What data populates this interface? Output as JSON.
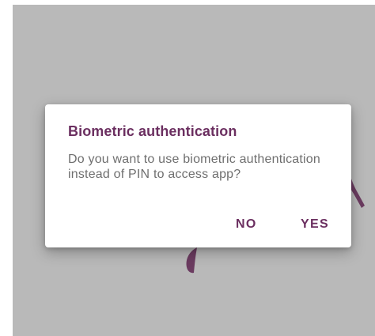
{
  "dialog": {
    "title": "Biometric authentication",
    "message": "Do you want to use biometric authentication instead of PIN to access app?",
    "negative_label": "NO",
    "positive_label": "YES"
  },
  "background": {
    "scrim_color": "#b9b9b9",
    "accent_color": "#6b2f60",
    "icons": [
      "leaf-icon",
      "magnifier-icon"
    ]
  }
}
